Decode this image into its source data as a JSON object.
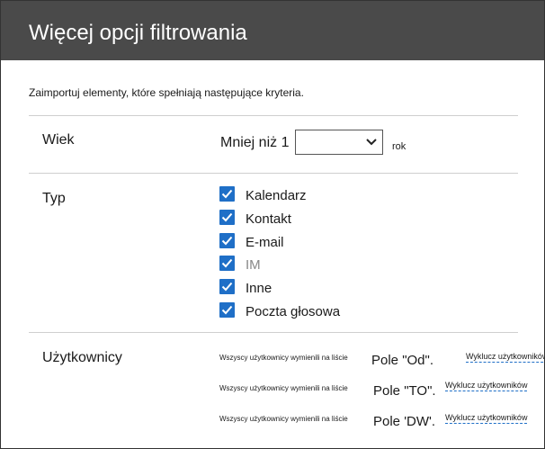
{
  "dialog": {
    "title": "Więcej opcji filtrowania",
    "intro": "Zaimportuj elementy, które spełniają następujące kryteria."
  },
  "age": {
    "label": "Wiek",
    "prefix": "Mniej niż 1",
    "select_value": "",
    "suffix": "rok"
  },
  "type": {
    "label": "Typ",
    "items": [
      {
        "label": "Kalendarz",
        "checked": true
      },
      {
        "label": "Kontakt",
        "checked": true
      },
      {
        "label": "E-mail",
        "checked": true
      },
      {
        "label": "IM",
        "checked": true
      },
      {
        "label": "Inne",
        "checked": true
      },
      {
        "label": "Poczta głosowa",
        "checked": true
      }
    ]
  },
  "users": {
    "label": "Użytkownicy",
    "rows": [
      {
        "desc": "Wszyscy użytkownicy wymienili na liście",
        "field": "Pole \"Od\".",
        "exclude": "Wyklucz użytkowników"
      },
      {
        "desc": "Wszyscy użytkownicy wymienili na liście",
        "field": "Pole \"TO\".",
        "exclude": "Wyklucz użytkowników"
      },
      {
        "desc": "Wszyscy użytkownicy wymienili na liście",
        "field": "Pole 'DW'.",
        "exclude": "Wyklucz użytkowników"
      }
    ]
  },
  "colors": {
    "titlebar": "#4a4a4a",
    "checkbox": "#1f6fc7"
  }
}
